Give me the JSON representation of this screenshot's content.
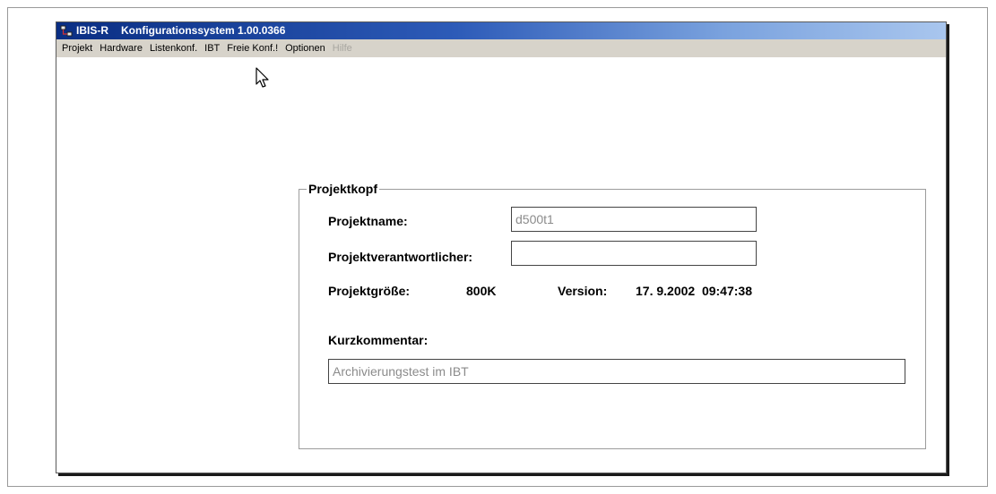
{
  "window": {
    "app_name": "IBIS-R",
    "title": "Konfigurationssystem 1.00.0366"
  },
  "menu": [
    "Projekt",
    "Hardware",
    "Listenkonf.",
    "IBT",
    "Freie Konf.!",
    "Optionen"
  ],
  "menu_disabled": "Hilfe",
  "projektkopf": {
    "legend": "Projektkopf",
    "projektname_label": "Projektname:",
    "projektname_value": "d500t1",
    "verantwortlicher_label": "Projektverantwortlicher:",
    "verantwortlicher_value": "",
    "groesse_label": "Projektgröße:",
    "groesse_value": "800K",
    "version_label": "Version:",
    "version_value": "17. 9.2002  09:47:38",
    "kommentar_label": "Kurzkommentar:",
    "kommentar_value": "Archivierungstest im IBT"
  },
  "icons": {
    "app": "app-network-icon",
    "cursor": "mouse-pointer-icon"
  },
  "colors": {
    "titlebar_start": "#0a2e83",
    "titlebar_end": "#a9c6ee",
    "menubar_bg": "#d7d3ca"
  }
}
